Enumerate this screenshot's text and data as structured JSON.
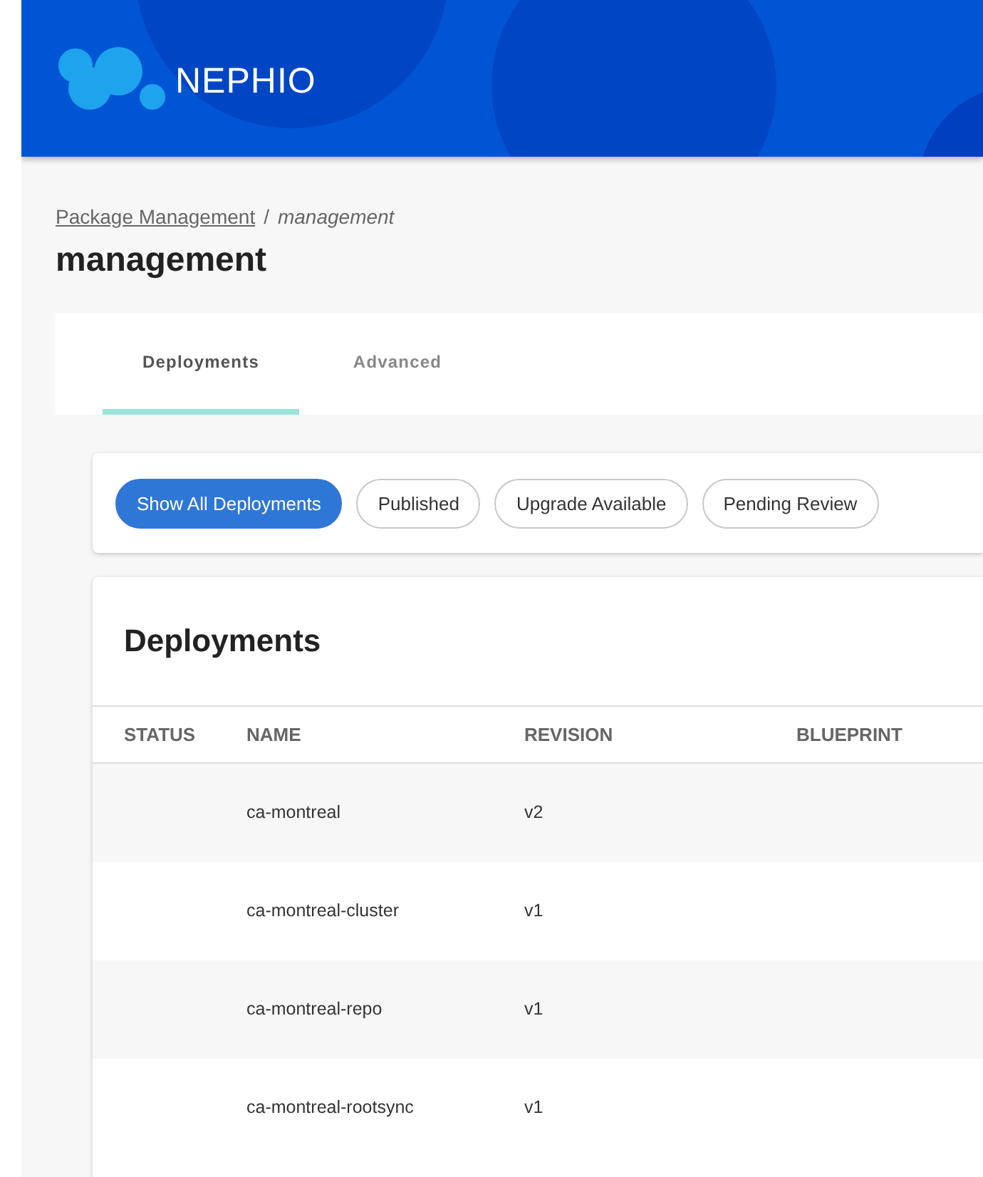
{
  "header": {
    "logo_text": "NEPHIO"
  },
  "breadcrumb": {
    "link": "Package Management",
    "separator": "/",
    "current": "management"
  },
  "page_title": "management",
  "tabs": [
    {
      "label": "Deployments",
      "selected": true
    },
    {
      "label": "Advanced",
      "selected": false
    }
  ],
  "filters": [
    {
      "label": "Show All Deployments",
      "selected": true
    },
    {
      "label": "Published",
      "selected": false
    },
    {
      "label": "Upgrade Available",
      "selected": false
    },
    {
      "label": "Pending Review",
      "selected": false
    }
  ],
  "table": {
    "title": "Deployments",
    "columns": [
      "STATUS",
      "NAME",
      "REVISION",
      "BLUEPRINT"
    ],
    "rows": [
      {
        "name": "ca-montreal",
        "revision": "v2"
      },
      {
        "name": "ca-montreal-cluster",
        "revision": "v1"
      },
      {
        "name": "ca-montreal-repo",
        "revision": "v1"
      },
      {
        "name": "ca-montreal-rootsync",
        "revision": "v1"
      }
    ]
  }
}
